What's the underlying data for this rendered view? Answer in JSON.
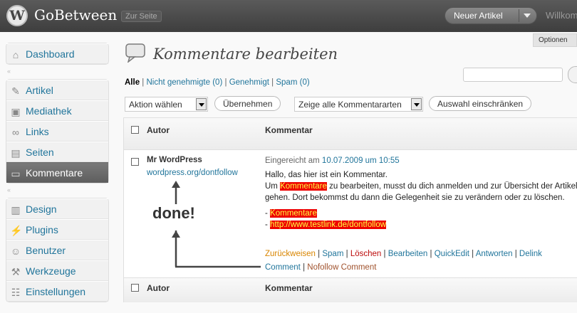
{
  "header": {
    "site_title": "GoBetween",
    "view_site": "Zur Seite",
    "favorite_action": "Neuer Artikel",
    "welcome": "Willkom",
    "screen_options": "Optionen"
  },
  "sidebar": {
    "group1": [
      {
        "label": "Dashboard",
        "icon": "dashboard-icon"
      }
    ],
    "group2": [
      {
        "label": "Artikel",
        "icon": "pin-icon"
      },
      {
        "label": "Mediathek",
        "icon": "media-icon"
      },
      {
        "label": "Links",
        "icon": "link-icon"
      },
      {
        "label": "Seiten",
        "icon": "pages-icon"
      },
      {
        "label": "Kommentare",
        "icon": "comment-icon"
      }
    ],
    "group3": [
      {
        "label": "Design",
        "icon": "appearance-icon"
      },
      {
        "label": "Plugins",
        "icon": "plugin-icon"
      },
      {
        "label": "Benutzer",
        "icon": "users-icon"
      },
      {
        "label": "Werkzeuge",
        "icon": "tools-icon"
      },
      {
        "label": "Einstellungen",
        "icon": "settings-icon"
      }
    ]
  },
  "page": {
    "title": "Kommentare bearbeiten"
  },
  "filters": {
    "all": "Alle",
    "sep": "|",
    "pending": "Nicht genehmigte",
    "pending_count": "0",
    "approved": "Genehmigt",
    "spam": "Spam",
    "spam_count": "0"
  },
  "toolbar": {
    "bulk_action": "Aktion wählen",
    "apply": "Übernehmen",
    "comment_type": "Zeige alle Kommentararten",
    "filter": "Auswahl einschränken"
  },
  "table": {
    "col_author": "Autor",
    "col_comment": "Kommentar",
    "rows": [
      {
        "author": "Mr WordPress",
        "author_url": "wordpress.org/dontfollow",
        "submitted_prefix": "Eingereicht am",
        "submitted_date": "10.07.2009 um 10:55",
        "line1": "Hallo, das hier ist ein Kommentar.",
        "line2_a": "Um",
        "line2_link": "Kommentare",
        "line2_b": "zu bearbeiten, musst du dich anmelden und zur Übersicht der Artikel gehen. Dort bekommst du dann die Gelegenheit sie zu verändern oder zu löschen.",
        "list_dash": "-",
        "list1": "Kommentare",
        "list2": "http://www.testlink.de/dontfollow"
      }
    ],
    "actions": {
      "unapprove": "Zurückweisen",
      "spam": "Spam",
      "delete": "Löschen",
      "edit": "Bearbeiten",
      "quickedit": "QuickEdit",
      "reply": "Antworten",
      "delink": "Delink Comment",
      "nofollow": "Nofollow Comment"
    }
  },
  "annotation": {
    "text": "done!"
  }
}
